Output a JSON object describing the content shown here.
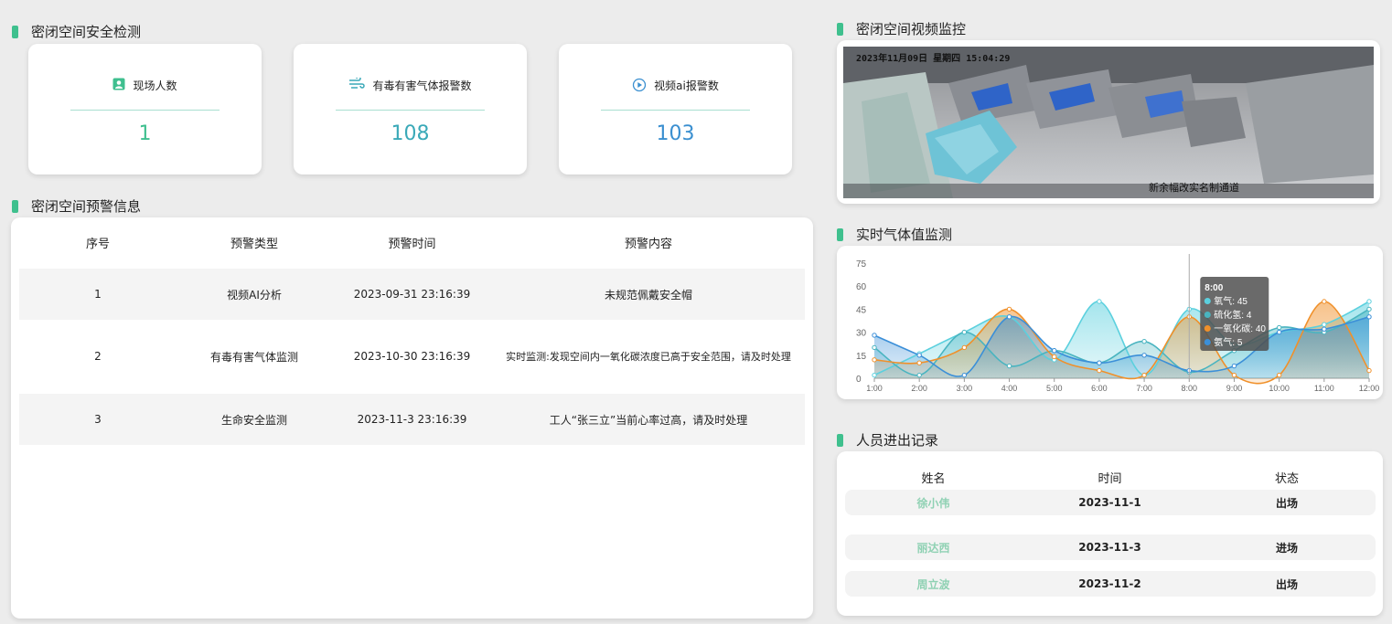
{
  "sections": {
    "safety": "密闭空间安全检测",
    "warning": "密闭空间预警信息",
    "video": "密闭空间视频监控",
    "gas": "实时气体值监测",
    "records": "人员进出记录"
  },
  "stats": [
    {
      "label": "现场人数",
      "value": "1",
      "icon": "person-badge-icon",
      "color": "#3fbf8f"
    },
    {
      "label": "有毒有害气体报警数",
      "value": "108",
      "icon": "wind-icon",
      "color": "#3aa9b8"
    },
    {
      "label": "视频ai报警数",
      "value": "103",
      "icon": "video-ai-icon",
      "color": "#3a8fd0"
    }
  ],
  "warning_table": {
    "columns": [
      "序号",
      "预警类型",
      "预警时间",
      "预警内容"
    ],
    "rows": [
      [
        "1",
        "视频AI分析",
        "2023-09-31 23:16:39",
        "未规范佩戴安全帽"
      ],
      [
        "2",
        "有毒有害气体监测",
        "2023-10-30 23:16:39",
        "实时监测:发现空间内一氧化碳浓度已高于安全范围，请及时处理"
      ],
      [
        "3",
        "生命安全监测",
        "2023-11-3 23:16:39",
        "工人“张三立”当前心率过高，请及时处理"
      ]
    ]
  },
  "video": {
    "overlay_time": "2023年11月09日 星期四 15:04:29",
    "overlay_caption": "新余幅改实名制通道"
  },
  "chart_data": {
    "type": "area",
    "x": [
      "1:00",
      "2:00",
      "3:00",
      "4:00",
      "5:00",
      "6:00",
      "7:00",
      "8:00",
      "9:00",
      "10:00",
      "11:00",
      "12:00"
    ],
    "ylim": [
      0,
      75
    ],
    "yticks": [
      0,
      15,
      30,
      45,
      60,
      75
    ],
    "series": [
      {
        "name": "氧气",
        "color": "#5bd0de",
        "values": [
          2,
          16,
          30,
          40,
          12,
          50,
          2,
          45,
          22,
          30,
          35,
          50
        ]
      },
      {
        "name": "硫化氢",
        "color": "#49b4c0",
        "values": [
          20,
          2,
          30,
          8,
          18,
          10,
          24,
          4,
          18,
          33,
          30,
          45
        ]
      },
      {
        "name": "一氧化碳",
        "color": "#f0902a",
        "values": [
          12,
          10,
          20,
          45,
          14,
          5,
          2,
          40,
          2,
          2,
          50,
          5
        ]
      },
      {
        "name": "氨气",
        "color": "#3b8fd8",
        "values": [
          28,
          15,
          2,
          40,
          18,
          10,
          15,
          5,
          8,
          30,
          32,
          40
        ]
      }
    ],
    "tooltip": {
      "title": "8:00",
      "items": [
        {
          "label": "氧气: 45",
          "color": "#5bd0de"
        },
        {
          "label": "硫化氢: 4",
          "color": "#49b4c0"
        },
        {
          "label": "一氧化碳: 40",
          "color": "#f0902a"
        },
        {
          "label": "氨气: 5",
          "color": "#3b8fd8"
        }
      ]
    }
  },
  "records": {
    "columns": [
      "姓名",
      "时间",
      "状态"
    ],
    "rows": [
      [
        "徐小伟",
        "2023-11-1",
        "出场"
      ],
      [
        "丽达西",
        "2023-11-3",
        "进场"
      ],
      [
        "周立波",
        "2023-11-2",
        "出场"
      ]
    ]
  }
}
